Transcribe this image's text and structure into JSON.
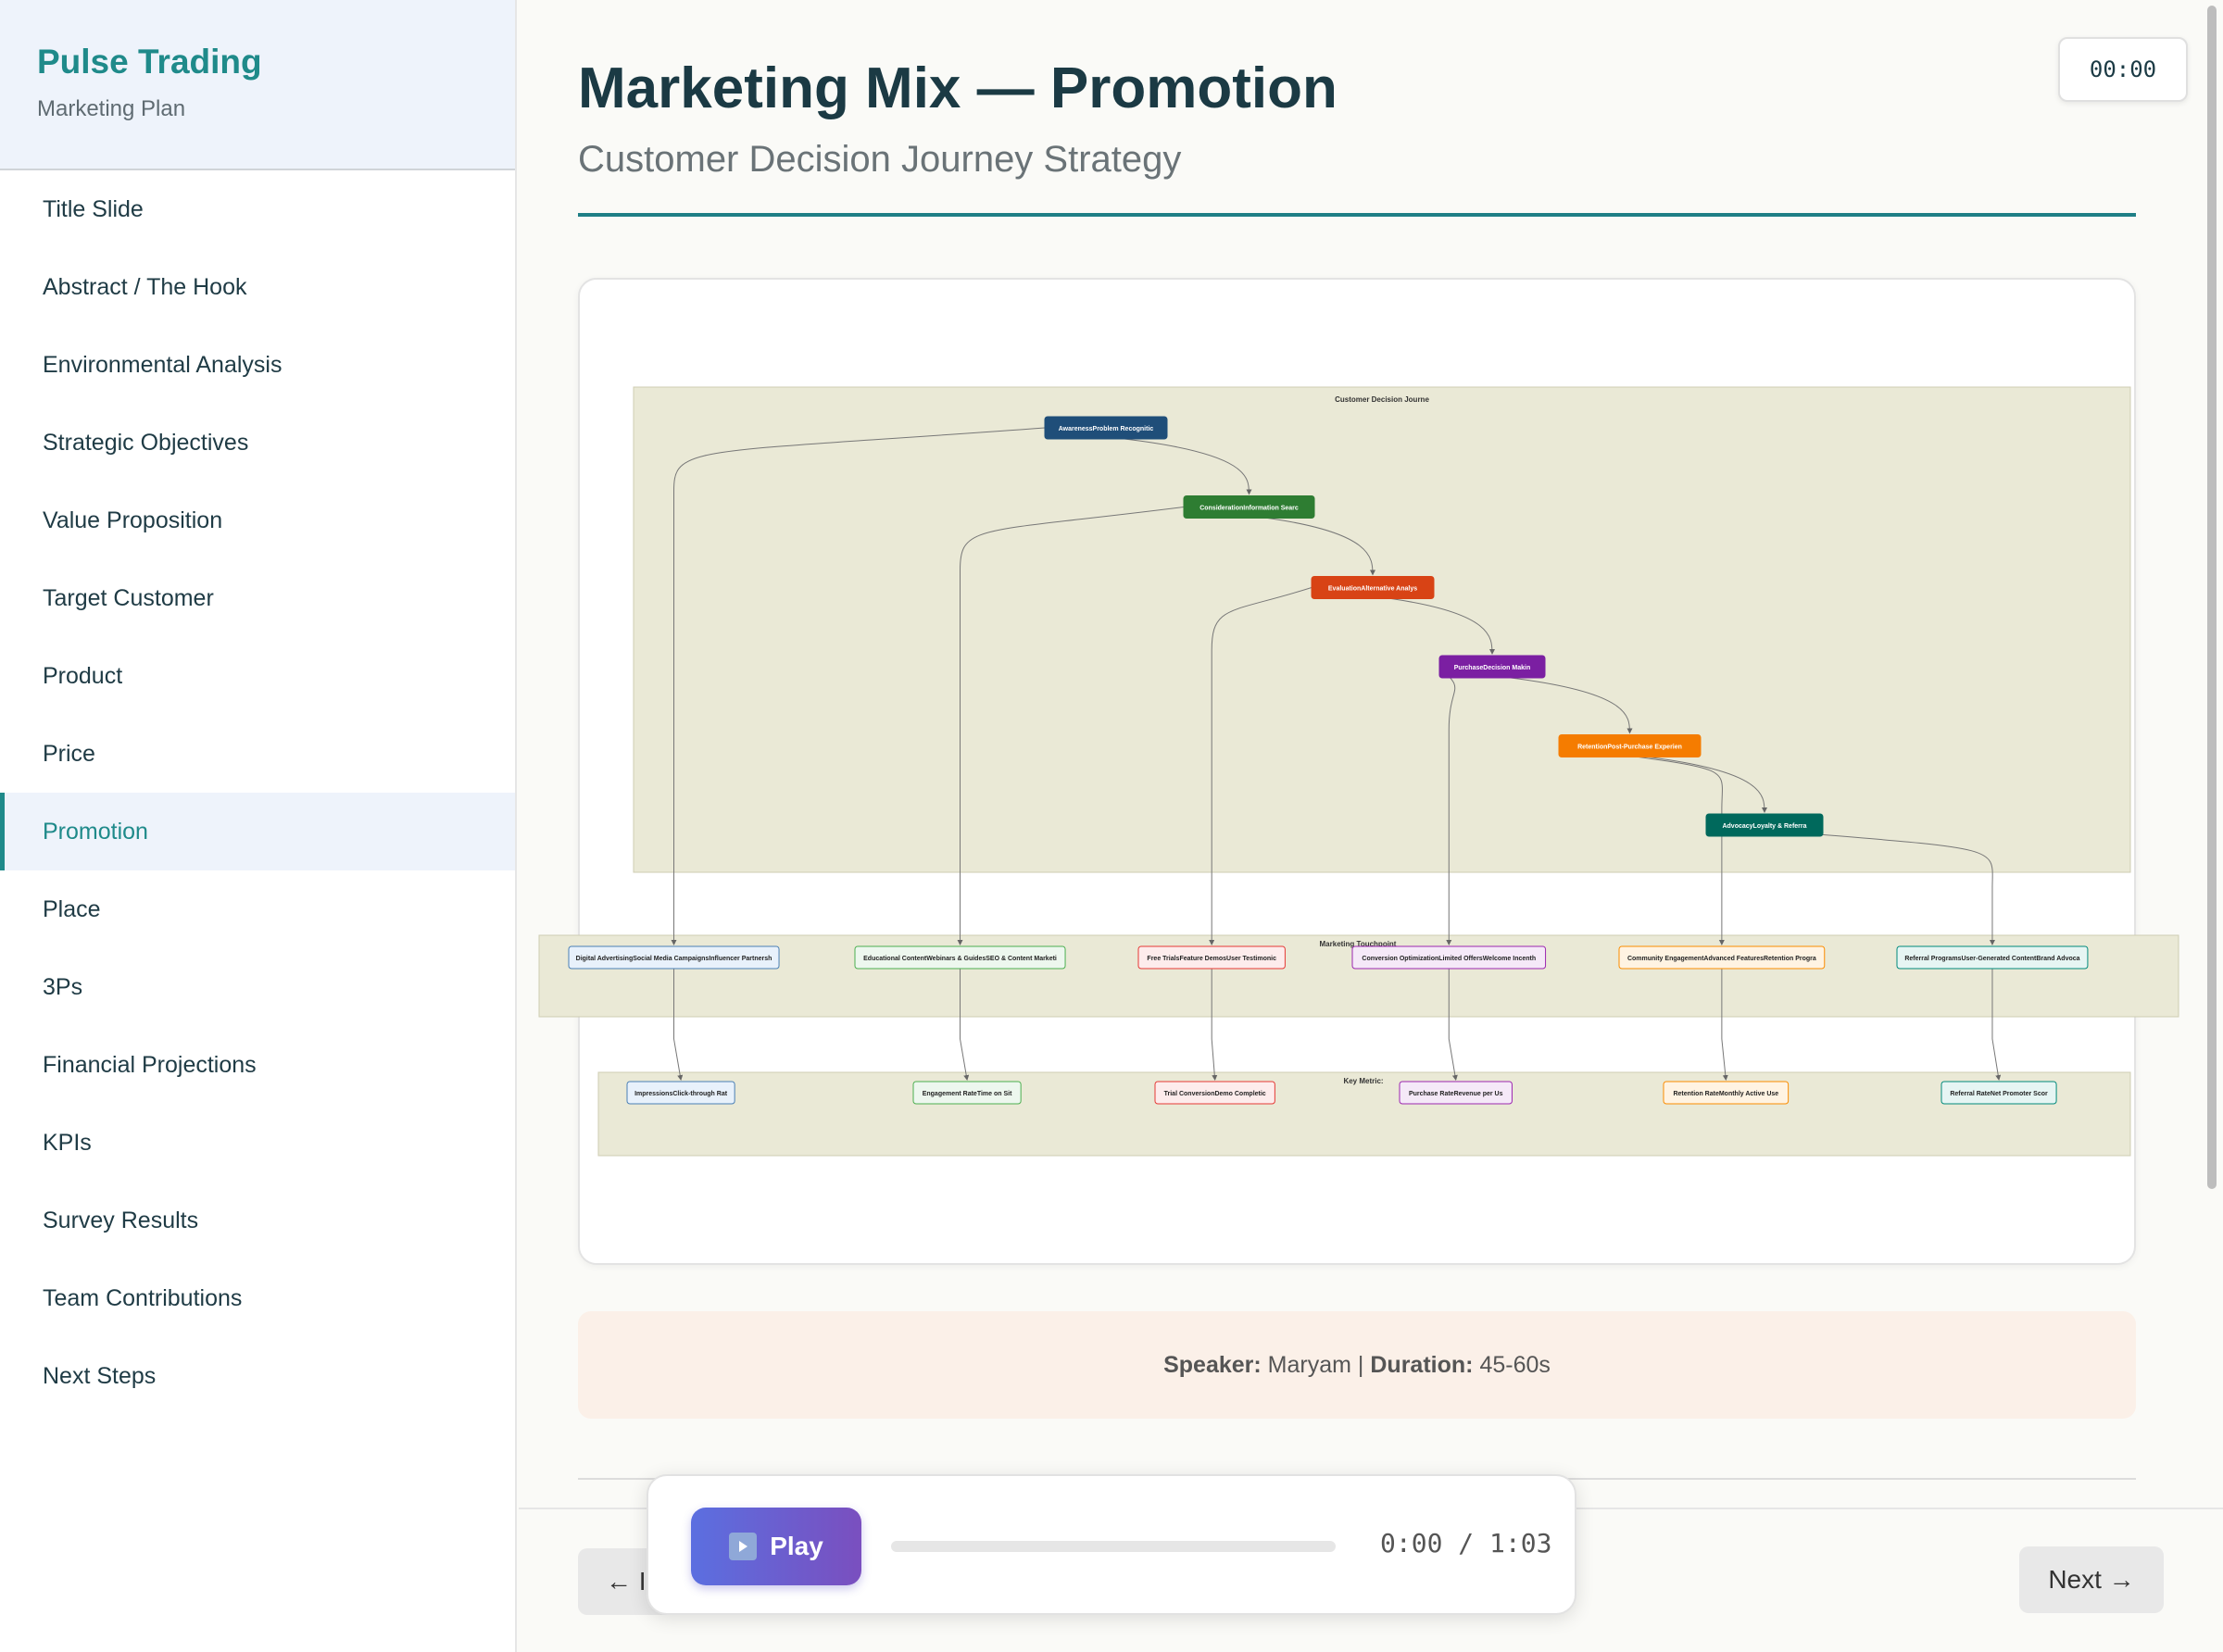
{
  "sidebar": {
    "title": "Pulse Trading",
    "subtitle": "Marketing Plan",
    "items": [
      {
        "label": "Title Slide"
      },
      {
        "label": "Abstract / The Hook"
      },
      {
        "label": "Environmental Analysis"
      },
      {
        "label": "Strategic Objectives"
      },
      {
        "label": "Value Proposition"
      },
      {
        "label": "Target Customer"
      },
      {
        "label": "Product"
      },
      {
        "label": "Price"
      },
      {
        "label": "Promotion",
        "active": true
      },
      {
        "label": "Place"
      },
      {
        "label": "3Ps"
      },
      {
        "label": "Financial Projections"
      },
      {
        "label": "KPIs"
      },
      {
        "label": "Survey Results"
      },
      {
        "label": "Team Contributions"
      },
      {
        "label": "Next Steps"
      }
    ]
  },
  "header": {
    "title": "Marketing Mix — Promotion",
    "subtitle": "Customer Decision Journey Strategy",
    "timer": "00:00"
  },
  "diagram": {
    "group_journey": "Customer Decision Journe",
    "group_touchpoints": "Marketing Touchpoint",
    "group_metrics": "Key Metric:",
    "stages": [
      {
        "label": "AwarenessProblem Recognitic",
        "color": "#1f4e79"
      },
      {
        "label": "ConsiderationInformation Searc",
        "color": "#2e7d32"
      },
      {
        "label": "EvaluationAlternative Analys",
        "color": "#d84315"
      },
      {
        "label": "PurchaseDecision Makin",
        "color": "#7b1fa2"
      },
      {
        "label": "RetentionPost-Purchase Experien",
        "color": "#f57c00"
      },
      {
        "label": "AdvocacyLoyalty & Referra",
        "color": "#00695c"
      }
    ],
    "touchpoints": [
      {
        "label": "Digital AdvertisingSocial Media CampaignsInfluencer Partnersh",
        "border": "#4a7fb5",
        "bg": "#e8f1fb"
      },
      {
        "label": "Educational ContentWebinars & GuidesSEO & Content Marketi",
        "border": "#4caf50",
        "bg": "#edf7ee"
      },
      {
        "label": "Free TrialsFeature DemosUser Testimonic",
        "border": "#e53935",
        "bg": "#fdecec"
      },
      {
        "label": "Conversion OptimizationLimited OffersWelcome Incenth",
        "border": "#9c27b0",
        "bg": "#f5e9f8"
      },
      {
        "label": "Community EngagementAdvanced FeaturesRetention Progra",
        "border": "#fb8c00",
        "bg": "#fff3e2"
      },
      {
        "label": "Referral ProgramsUser-Generated ContentBrand Advoca",
        "border": "#00897b",
        "bg": "#e6f5f3"
      }
    ],
    "metrics": [
      {
        "label": "ImpressionsClick-through Rat",
        "border": "#4a7fb5",
        "bg": "#e8f1fb"
      },
      {
        "label": "Engagement RateTime on Sit",
        "border": "#4caf50",
        "bg": "#edf7ee"
      },
      {
        "label": "Trial ConversionDemo Completic",
        "border": "#e53935",
        "bg": "#fdecec"
      },
      {
        "label": "Purchase RateRevenue per Us",
        "border": "#9c27b0",
        "bg": "#f5e9f8"
      },
      {
        "label": "Retention RateMonthly Active Use",
        "border": "#fb8c00",
        "bg": "#fff3e2"
      },
      {
        "label": "Referral RateNet Promoter Scor",
        "border": "#00897b",
        "bg": "#e6f5f3"
      }
    ]
  },
  "speaker": {
    "speaker_label": "Speaker:",
    "speaker_name": "Maryam",
    "separator": "|",
    "duration_label": "Duration:",
    "duration_value": "45-60s"
  },
  "nav": {
    "prev_label": "← I",
    "next_label": "Next →"
  },
  "player": {
    "play_label": "Play",
    "time": "0:00 / 1:03",
    "progress": 0
  }
}
